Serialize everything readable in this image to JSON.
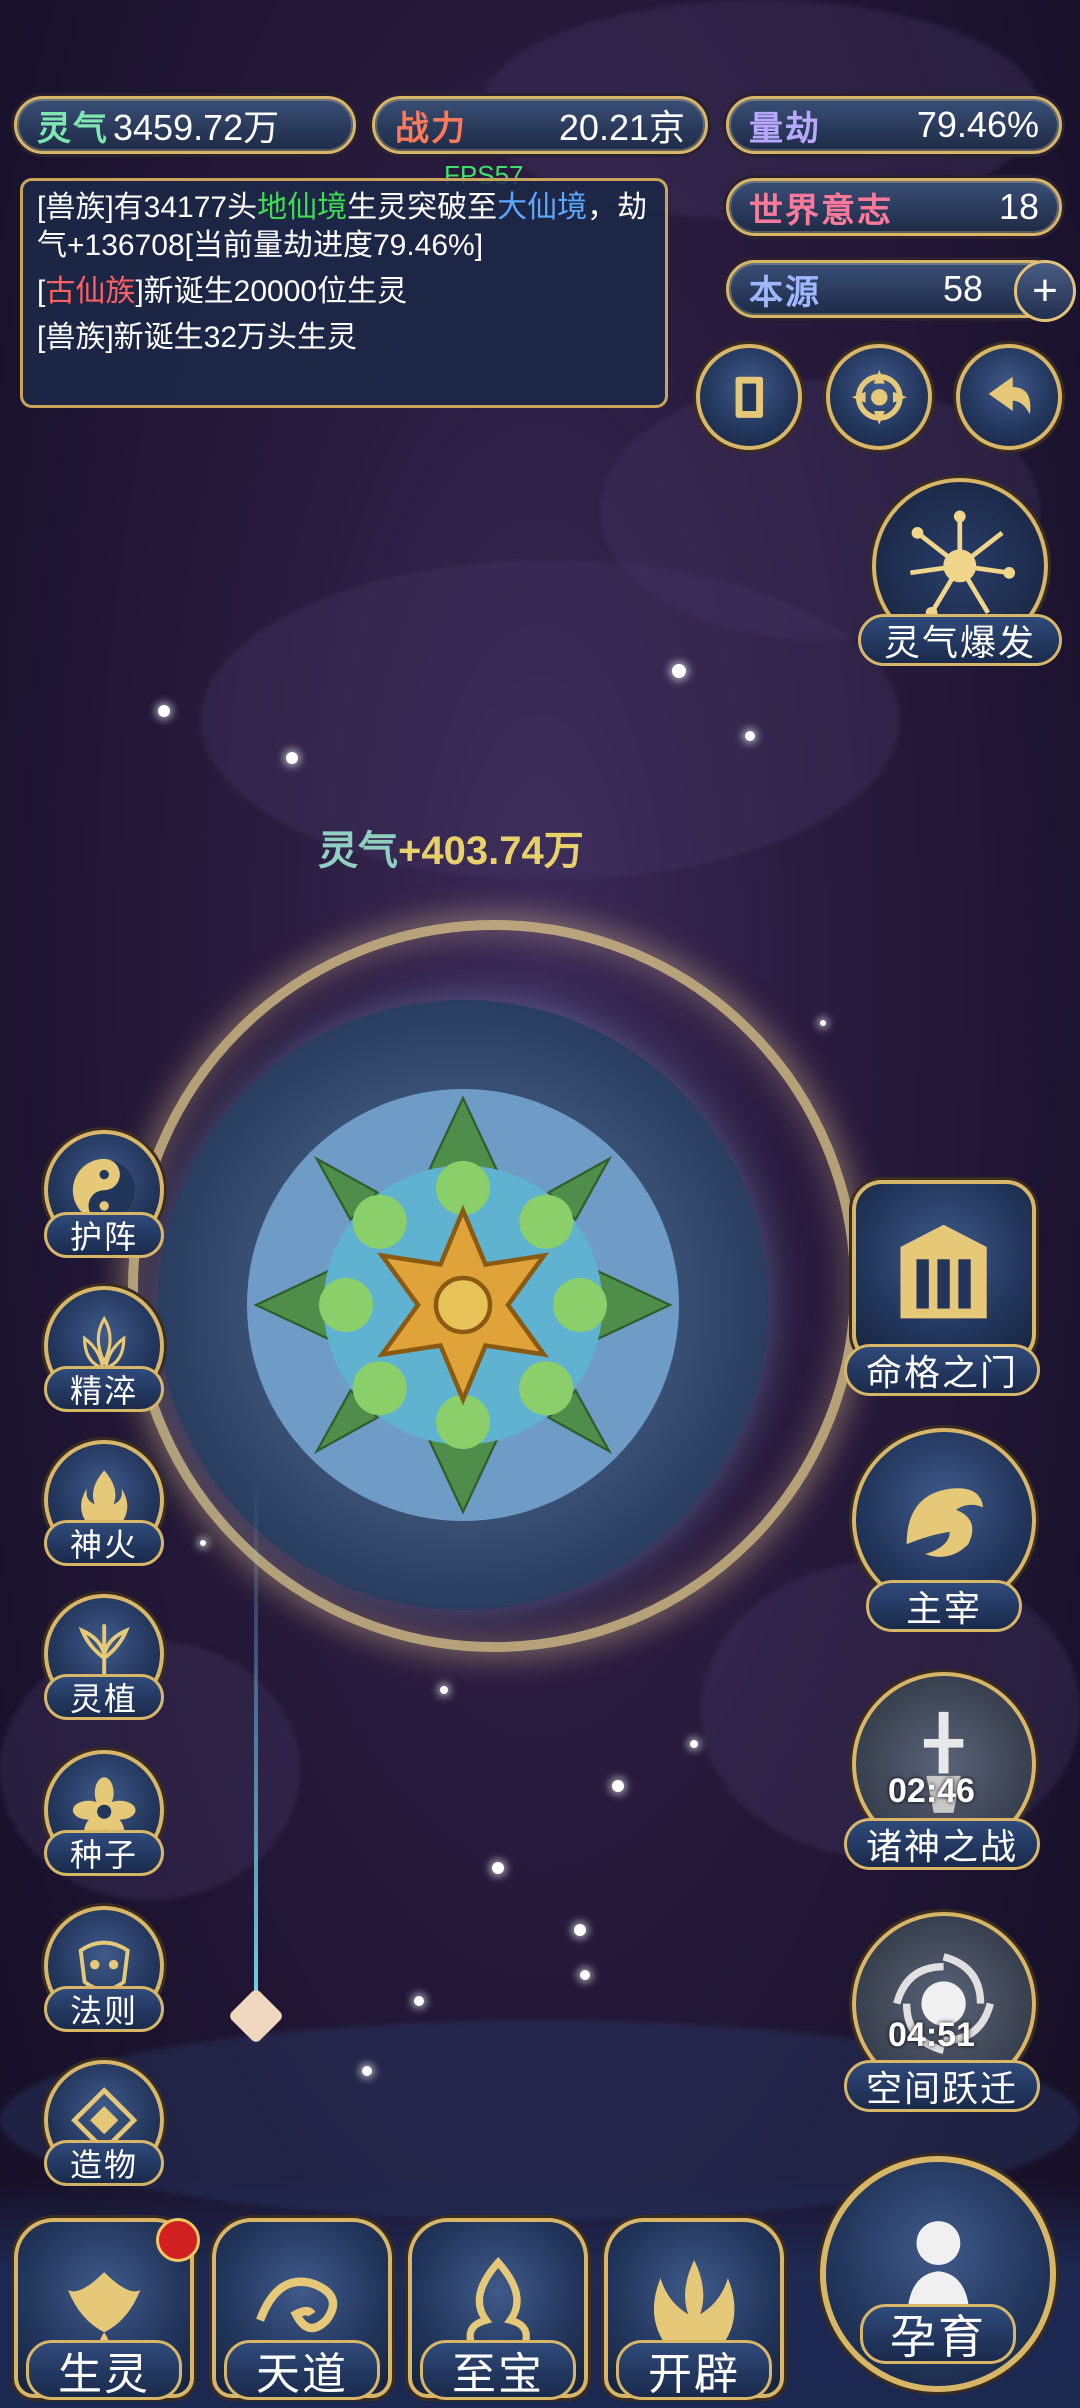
{
  "hud": {
    "lingqi": {
      "label": "灵气",
      "value": "3459.72万"
    },
    "zhanli": {
      "label": "战力",
      "value": "20.21京"
    },
    "liangjie": {
      "label": "量劫",
      "value": "79.46%"
    },
    "shijie": {
      "label": "世界意志",
      "value": "18"
    },
    "benyuan": {
      "label": "本源",
      "value": "58"
    },
    "fps": "FPS57"
  },
  "log": {
    "line1": {
      "a": "[兽族]有34177头",
      "b": "地仙境",
      "c": "生灵突破至",
      "d": "大仙境",
      "e": "，劫气+136708[当前量劫进度79.46%]"
    },
    "line2": {
      "a": "[",
      "b": "古仙族",
      "c": "]新诞生20000位生灵"
    },
    "line3": "[兽族]新诞生32万头生灵"
  },
  "top_buttons": {
    "burst_label": "灵气爆发"
  },
  "floating_gain": {
    "label": "灵气",
    "value": "+403.74万"
  },
  "left_menu": [
    "护阵",
    "精淬",
    "神火",
    "灵植",
    "种子",
    "法则",
    "造物"
  ],
  "right_menu": {
    "mingge": "命格之门",
    "zhuzai": "主宰",
    "zhushen": {
      "label": "诸神之战",
      "timer": "02:46"
    },
    "kongjian": {
      "label": "空间跃迁",
      "timer": "04:51"
    }
  },
  "bottom_menu": [
    "生灵",
    "天道",
    "至宝",
    "开辟",
    "孕育"
  ],
  "colors": {
    "gold": "#d8b667",
    "panel": "#1c2848",
    "accent_green": "#3fdc4f"
  }
}
